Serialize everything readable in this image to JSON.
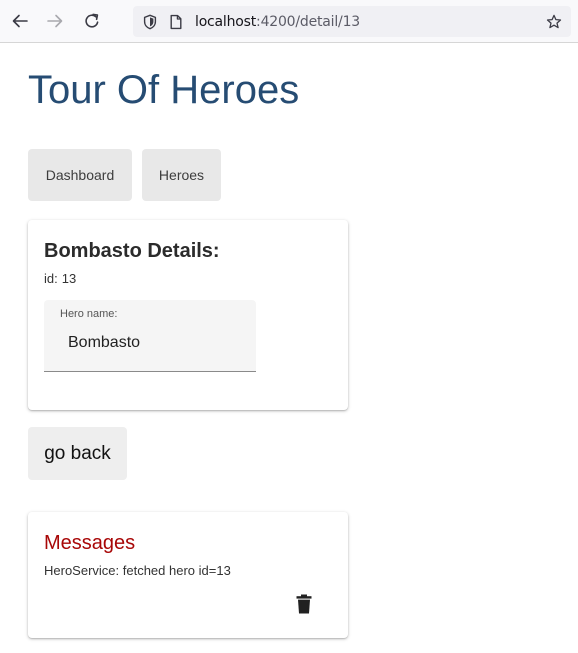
{
  "browser": {
    "url_host": "localhost",
    "url_path": ":4200/detail/13",
    "icons": {
      "back": "arrow-left-icon",
      "forward": "arrow-right-icon",
      "reload": "reload-icon",
      "shield": "shield-icon",
      "page": "page-icon",
      "bookmark": "star-icon"
    }
  },
  "app": {
    "title": "Tour Of Heroes",
    "title_color": "#264c73"
  },
  "nav": {
    "dashboard_label": "Dashboard",
    "heroes_label": "Heroes"
  },
  "detail": {
    "heading": "Bombasto Details:",
    "id_label": "id:",
    "id_value": "13",
    "name_label": "Hero name:",
    "name_value": "Bombasto"
  },
  "go_back_label": "go back",
  "messages": {
    "title": "Messages",
    "title_color": "#a80707",
    "items": [
      "HeroService: fetched hero id=13"
    ],
    "clear_icon": "trash-icon"
  }
}
